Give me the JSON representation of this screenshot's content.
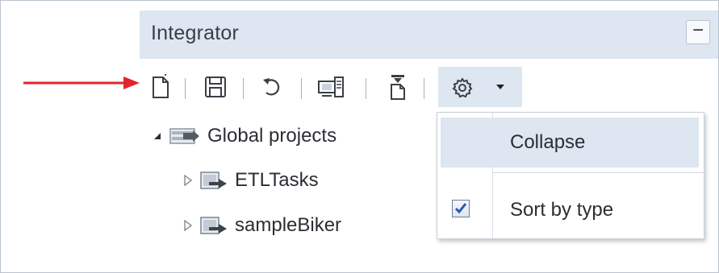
{
  "panel": {
    "title": "Integrator",
    "minimize_label": "−"
  },
  "toolbar": {
    "buttons": [
      {
        "icon": "new-file-icon"
      },
      {
        "icon": "save-icon"
      },
      {
        "icon": "refresh-icon"
      },
      {
        "icon": "deploy-icon"
      },
      {
        "icon": "upload-icon"
      },
      {
        "icon": "gear-icon"
      }
    ]
  },
  "tree": {
    "root": {
      "label": "Global projects",
      "expanded": true
    },
    "children": [
      {
        "label": "ETLTasks",
        "expanded": false
      },
      {
        "label": "sampleBiker",
        "expanded": false
      }
    ]
  },
  "menu": {
    "items": [
      {
        "label": "Collapse",
        "highlighted": true
      },
      {
        "label": "Sort by type",
        "checked": true
      }
    ]
  },
  "colors": {
    "header_bg": "#dde6f1",
    "annotation_arrow": "#e0262b",
    "checkmark": "#2a57b4"
  }
}
